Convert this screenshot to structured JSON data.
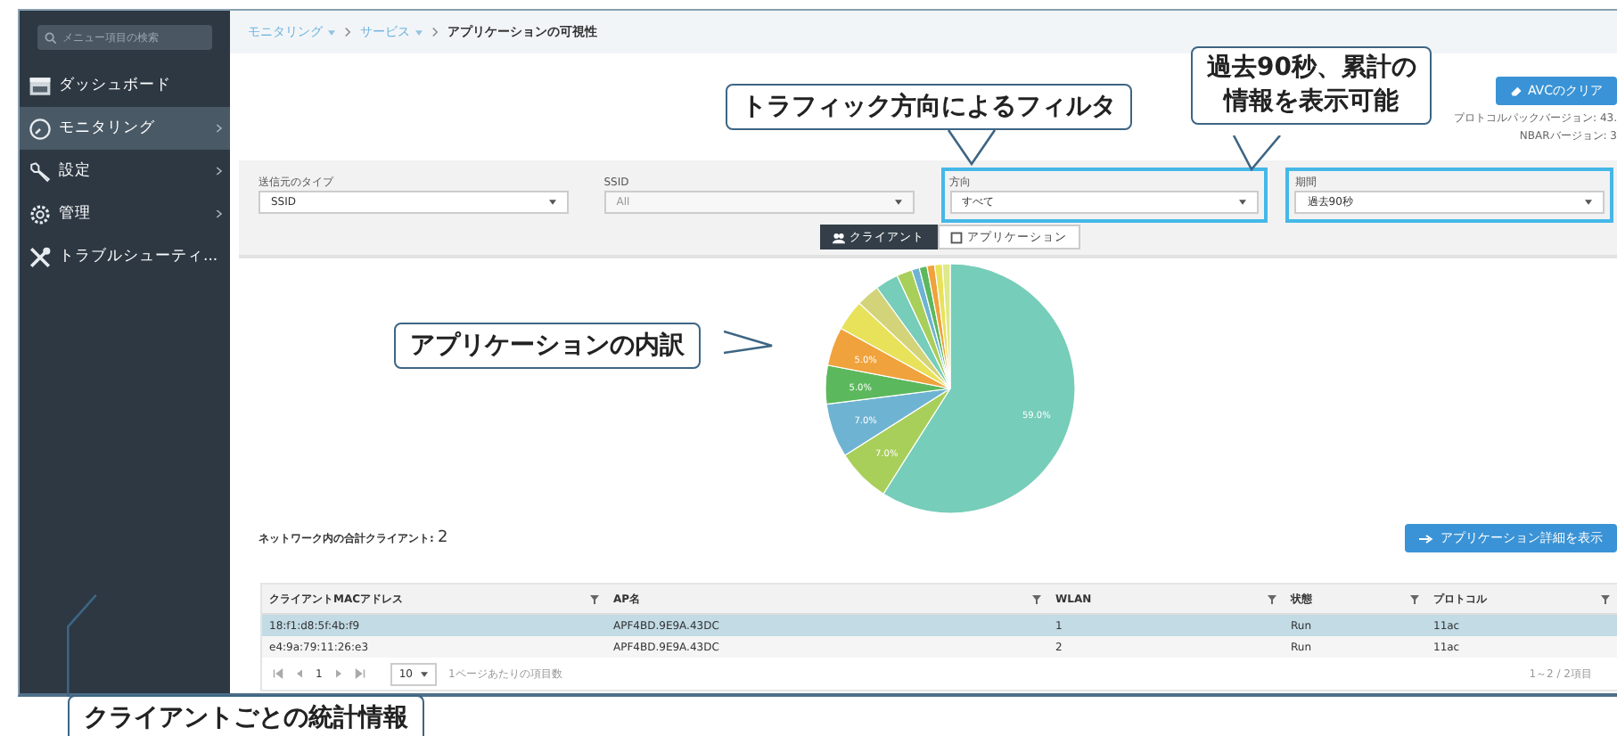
{
  "sidebar": {
    "search": {
      "placeholder": "メニュー項目の検索"
    },
    "items": [
      {
        "label": "ダッシュボード",
        "kind": "dashboard",
        "selected": false,
        "expandable": false
      },
      {
        "label": "モニタリング",
        "kind": "monitoring",
        "selected": true,
        "expandable": true
      },
      {
        "label": "設定",
        "kind": "config",
        "selected": false,
        "expandable": true
      },
      {
        "label": "管理",
        "kind": "admin",
        "selected": false,
        "expandable": true
      },
      {
        "label": "トラブルシューティ...",
        "kind": "troubleshoot",
        "selected": false,
        "expandable": false
      }
    ]
  },
  "breadcrumb": [
    {
      "label": "モニタリング",
      "current": false
    },
    {
      "label": "サービス",
      "current": false
    },
    {
      "label": "アプリケーションの可視性",
      "current": true
    }
  ],
  "avc_button": "AVCのクリア",
  "versions": [
    "プロトコルパックバージョン: 43.",
    "NBARバージョン: 3"
  ],
  "filters": [
    {
      "label": "送信元のタイプ",
      "value": "SSID",
      "disabled": false,
      "highlighted": false
    },
    {
      "label": "SSID",
      "value": "All",
      "disabled": true,
      "highlighted": false
    },
    {
      "label": "方向",
      "value": "すべて",
      "disabled": false,
      "highlighted": true
    },
    {
      "label": "期間",
      "value": "過去90秒",
      "disabled": false,
      "highlighted": true
    }
  ],
  "view_toggle": [
    {
      "label": "クライアント",
      "kind": "clients",
      "selected": true
    },
    {
      "label": "アプリケーション",
      "kind": "apps",
      "selected": false
    }
  ],
  "chart_data": {
    "type": "pie",
    "values": [
      59,
      7,
      7,
      5,
      5,
      4,
      3,
      3,
      2,
      1,
      1,
      1,
      1,
      1
    ],
    "colors": [
      "#76cdb9",
      "#a8cf5a",
      "#6fb3d2",
      "#5cb85c",
      "#f0a23c",
      "#e8e25a",
      "#d3d37a",
      "#76cdb9",
      "#a8cf5a",
      "#6fb3d2",
      "#5cb85c",
      "#f0a23c",
      "#e8e25a",
      "#dde98a"
    ],
    "value_labels": [
      "59.0%",
      "7.0%",
      "7.0%",
      "5.0%",
      "5.0%",
      null,
      null,
      null,
      null,
      null,
      null,
      null,
      null,
      null
    ]
  },
  "total": {
    "label": "ネットワーク内の合計クライアント:",
    "value": "2"
  },
  "details_button": "アプリケーション詳細を表示",
  "table": {
    "columns": [
      "クライアントMACアドレス",
      "AP名",
      "WLAN",
      "状態",
      "プロトコル"
    ],
    "rows": [
      {
        "cells": [
          "18:f1:d8:5f:4b:f9",
          "APF4BD.9E9A.43DC",
          "1",
          "Run",
          "11ac"
        ],
        "selected": true
      },
      {
        "cells": [
          "e4:9a:79:11:26:e3",
          "APF4BD.9E9A.43DC",
          "2",
          "Run",
          "11ac"
        ],
        "selected": false
      }
    ]
  },
  "pager": {
    "page": "1",
    "page_size": "10",
    "page_size_label": "1ページあたりの項目数",
    "range": "1～2 / 2項目"
  },
  "callouts": [
    {
      "lines": [
        "トラフィック方向によるフィルタ"
      ]
    },
    {
      "lines": [
        "過去90秒、累計の",
        "情報を表示可能"
      ]
    },
    {
      "lines": [
        "アプリケーションの内訳"
      ]
    },
    {
      "lines": [
        "クライアントごとの統計情報"
      ]
    }
  ]
}
